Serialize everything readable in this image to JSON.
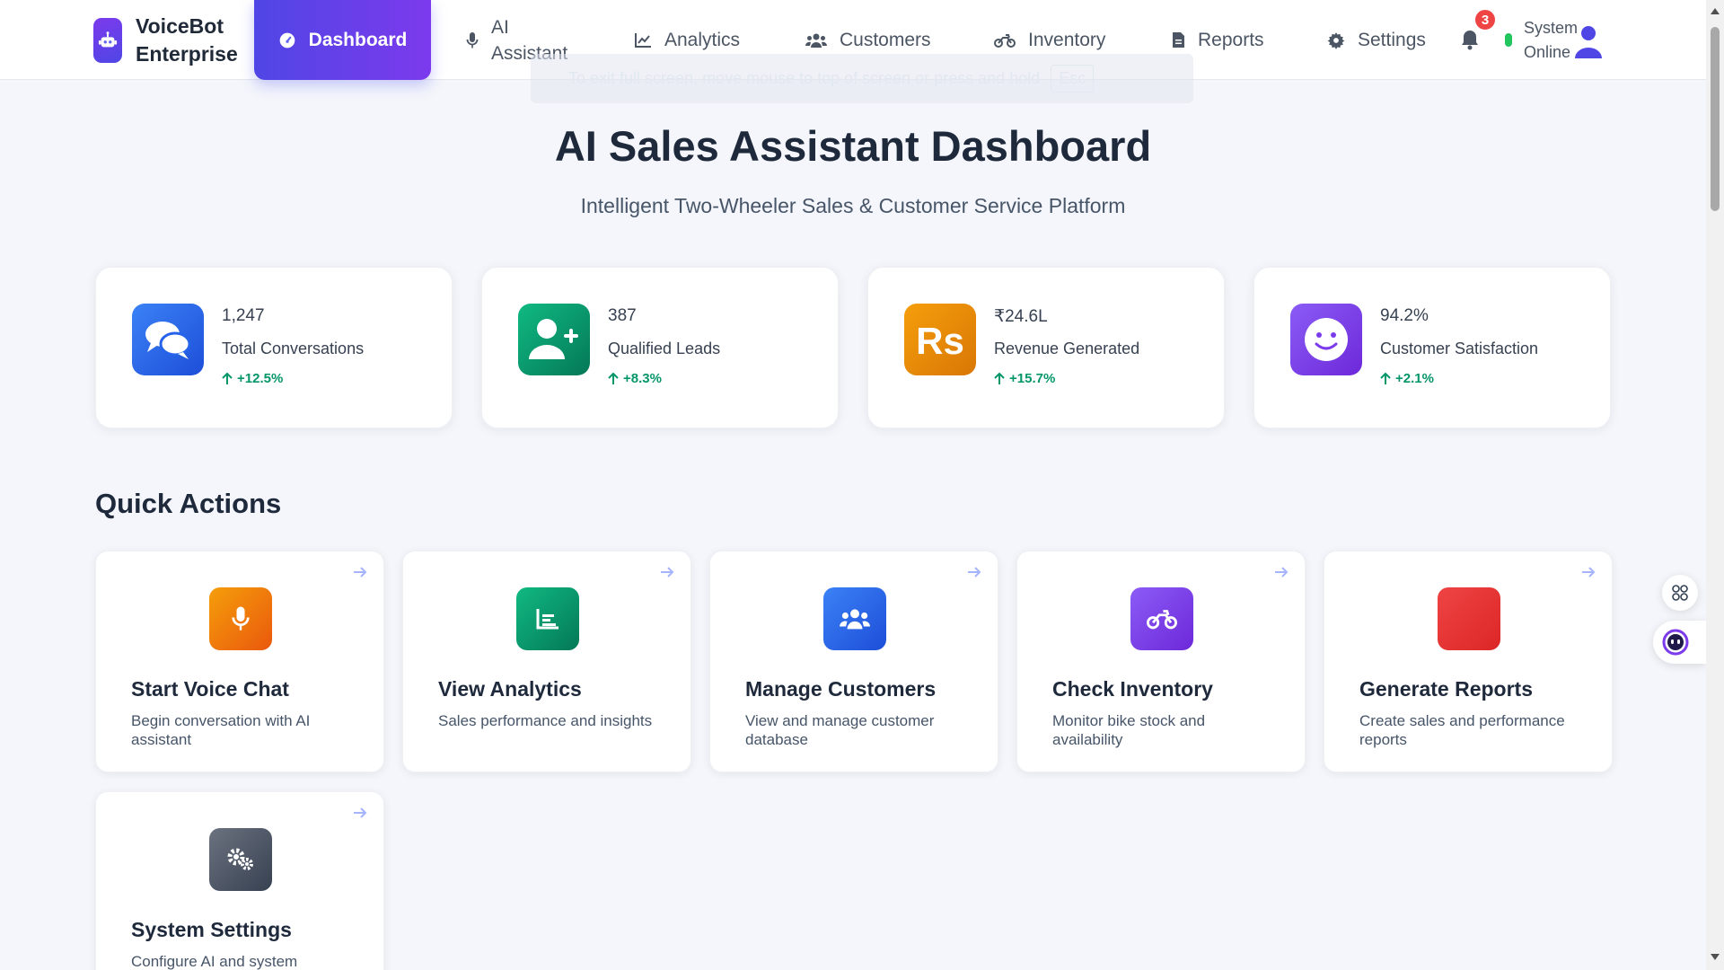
{
  "brand": {
    "name": "VoiceBot Enterprise",
    "icon": "robot-icon"
  },
  "nav": {
    "items": [
      {
        "label": "Dashboard",
        "icon": "gauge-icon",
        "active": true
      },
      {
        "label": "AI Assistant",
        "icon": "microphone-icon"
      },
      {
        "label": "Analytics",
        "icon": "line-chart-icon"
      },
      {
        "label": "Customers",
        "icon": "users-icon"
      },
      {
        "label": "Inventory",
        "icon": "motorcycle-icon"
      },
      {
        "label": "Reports",
        "icon": "file-icon"
      },
      {
        "label": "Settings",
        "icon": "gear-icon"
      }
    ],
    "notification_count": "3",
    "status": "System Online"
  },
  "fullscreen_hint": {
    "text": "To exit full screen, move mouse to top of screen or press and hold",
    "key": "Esc"
  },
  "hero": {
    "title": "AI Sales Assistant Dashboard",
    "subtitle": "Intelligent Two-Wheeler Sales & Customer Service Platform"
  },
  "stats": [
    {
      "value": "1,247",
      "label": "Total Conversations",
      "change": "+12.5%",
      "icon": "comments-icon",
      "color": "#2563eb"
    },
    {
      "value": "387",
      "label": "Qualified Leads",
      "change": "+8.3%",
      "icon": "user-plus-icon",
      "color": "#059669"
    },
    {
      "value": "₹24.6L",
      "label": "Revenue Generated",
      "change": "+15.7%",
      "icon": "rupee-icon",
      "color": "#ea8a06"
    },
    {
      "value": "94.2%",
      "label": "Customer Satisfaction",
      "change": "+2.1%",
      "icon": "smile-icon",
      "color": "#7c3aed"
    }
  ],
  "quick_actions": {
    "title": "Quick Actions",
    "items": [
      {
        "title": "Start Voice Chat",
        "desc": "Begin conversation with AI assistant",
        "icon": "microphone-icon",
        "color": "#ea8a06"
      },
      {
        "title": "View Analytics",
        "desc": "Sales performance and insights",
        "icon": "chart-icon",
        "color": "#059669"
      },
      {
        "title": "Manage Customers",
        "desc": "View and manage customer database",
        "icon": "users-icon",
        "color": "#2563eb"
      },
      {
        "title": "Check Inventory",
        "desc": "Monitor bike stock and availability",
        "icon": "motorcycle-icon",
        "color": "#7c3aed"
      },
      {
        "title": "Generate Reports",
        "desc": "Create sales and performance reports",
        "icon": "report-icon",
        "color": "#dc2626"
      },
      {
        "title": "System Settings",
        "desc": "Configure AI and system preferences",
        "icon": "gears-icon",
        "color": "#4b5563"
      }
    ]
  }
}
